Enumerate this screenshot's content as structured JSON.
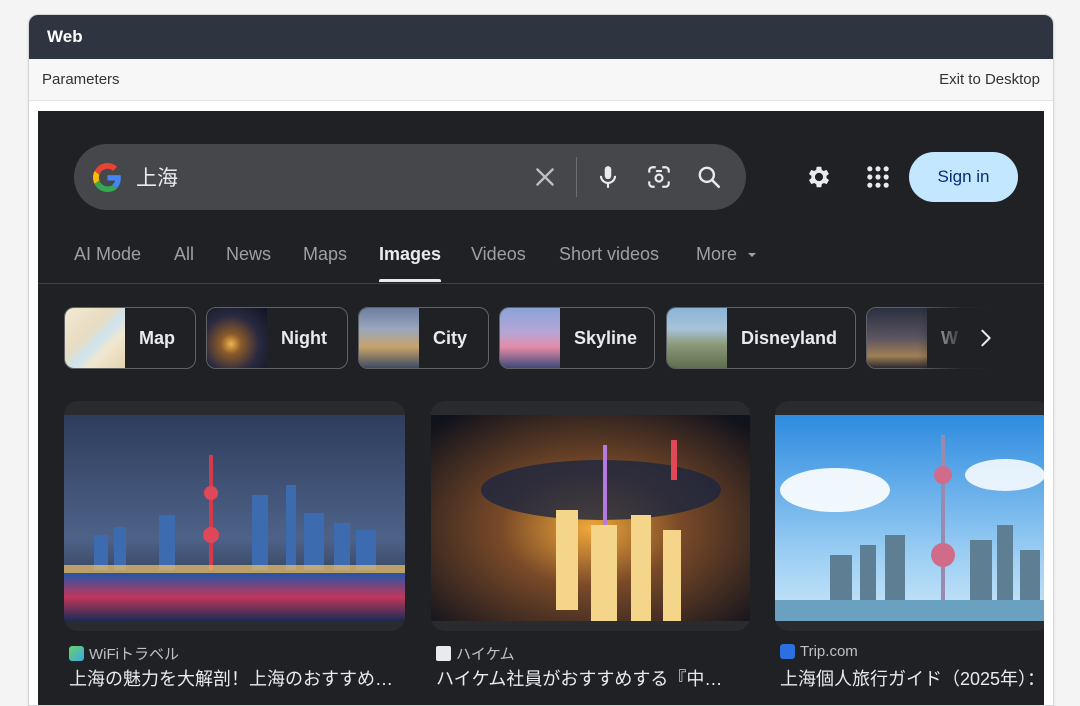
{
  "window": {
    "title": "Web"
  },
  "menubar": {
    "parameters_label": "Parameters",
    "exit_label": "Exit to Desktop"
  },
  "search": {
    "query": "上海"
  },
  "header": {
    "sign_in_label": "Sign in"
  },
  "tabs": [
    {
      "label": "AI Mode"
    },
    {
      "label": "All"
    },
    {
      "label": "News"
    },
    {
      "label": "Maps"
    },
    {
      "label": "Images",
      "active": true
    },
    {
      "label": "Videos"
    },
    {
      "label": "Short videos"
    },
    {
      "label": "More"
    }
  ],
  "chips": [
    {
      "label": "Map"
    },
    {
      "label": "Night"
    },
    {
      "label": "City"
    },
    {
      "label": "Skyline"
    },
    {
      "label": "Disneyland"
    },
    {
      "label": "W"
    }
  ],
  "results": [
    {
      "source": "WiFiトラベル",
      "title": "上海の魅力を大解剖！上海のおすすめ…"
    },
    {
      "source": "ハイケム",
      "title": "ハイケム社員がおすすめする『中…"
    },
    {
      "source": "Trip.com",
      "title": "上海個人旅行ガイド（2025年）："
    }
  ],
  "colors": {
    "page_bg": "#202124",
    "titlebar_bg": "#2f3540",
    "sign_in_bg": "#c2e7ff",
    "search_bg": "#45474b"
  },
  "icons": {
    "logo": "google-g-icon",
    "clear": "close-icon",
    "voice": "microphone-icon",
    "lens": "lens-icon",
    "search": "search-icon",
    "settings": "gear-icon",
    "apps": "apps-grid-icon",
    "more": "caret-down-icon",
    "chips_next": "chevron-right-icon"
  }
}
